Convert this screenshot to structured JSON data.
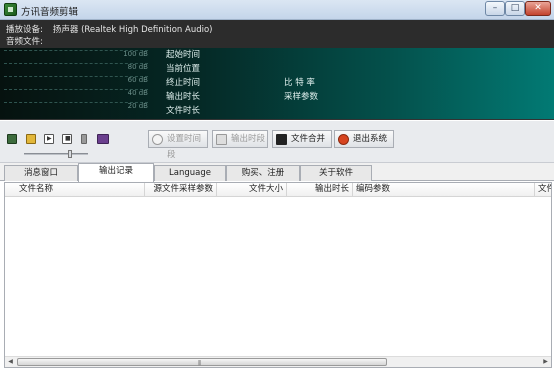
{
  "window": {
    "title": "方讯音频剪辑",
    "minimize": "0",
    "maximize": "1",
    "close": "r"
  },
  "info": {
    "device_label": "播放设备:",
    "device_value": "扬声器 (Realtek High Definition Audio)",
    "file_label": "音频文件:"
  },
  "meter": {
    "db_levels": [
      "100 dB",
      "80 dB",
      "60 dB",
      "40 dB",
      "20 dB"
    ],
    "labels_left": [
      "起始时间",
      "当前位置",
      "终止时间",
      "输出时长",
      "文件时长"
    ],
    "labels_right": [
      "比 特 率",
      "采样参数"
    ]
  },
  "toolbar": {
    "icons": [
      "record-icon",
      "open-folder-icon",
      "play-icon",
      "stop-icon",
      "volume-icon",
      "books-icon"
    ],
    "set_interval": "设置时间段",
    "output_interval": "输出时段",
    "merge_files": "文件合并",
    "exit": "退出系统",
    "volume_level_percent": 70
  },
  "tabs": [
    {
      "label": "消息窗口",
      "active": false
    },
    {
      "label": "输出记录",
      "active": true
    },
    {
      "label": "Language",
      "active": false
    },
    {
      "label": "购买、注册",
      "active": false
    },
    {
      "label": "关于软件",
      "active": false
    }
  ],
  "table": {
    "columns": [
      "文件名称",
      "源文件采样参数",
      "文件大小",
      "输出时长",
      "编码参数",
      "文件"
    ],
    "rows": []
  },
  "scrollbar": {
    "left_arrow": "◀",
    "right_arrow": "▶",
    "grip": "|||"
  }
}
